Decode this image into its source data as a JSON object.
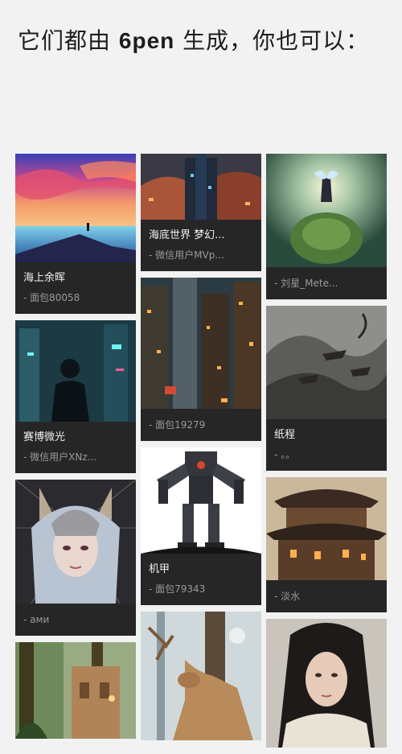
{
  "header": {
    "prefix": "它们都由 ",
    "brand": "6pen",
    "suffix": " 生成，你也可以：",
    "wrap": "："
  },
  "gallery": {
    "col1": [
      {
        "title": "海上余晖",
        "author": "- 面包80058",
        "image": "sunset-sea-image"
      },
      {
        "title": "赛博微光",
        "author": "- 微信用户XNz...",
        "image": "cyber-soldier-image"
      },
      {
        "title": "",
        "author": "- ами",
        "image": "silver-masked-girl-image"
      },
      {
        "title": "",
        "author": "",
        "image": "jungle-ruins-image"
      }
    ],
    "col2": [
      {
        "title": "海底世界 梦幻...",
        "author": "- 微信用户MVp...",
        "image": "underwater-city-image"
      },
      {
        "title": "",
        "author": "- 面包19279",
        "image": "steampunk-city-image"
      },
      {
        "title": "机甲",
        "author": "- 面包79343",
        "image": "mech-robot-image"
      },
      {
        "title": "",
        "author": "",
        "image": "deer-forest-image"
      }
    ],
    "col3": [
      {
        "title": "",
        "author": "- 刘星_Mete...",
        "image": "fairy-planet-image"
      },
      {
        "title": "纸程",
        "author": "- 。。",
        "image": "ink-mountain-temple-image"
      },
      {
        "title": "",
        "author": "- 淡水",
        "image": "chinese-palace-image"
      },
      {
        "title": "",
        "author": "",
        "image": "hooded-woman-portrait-image"
      }
    ]
  }
}
